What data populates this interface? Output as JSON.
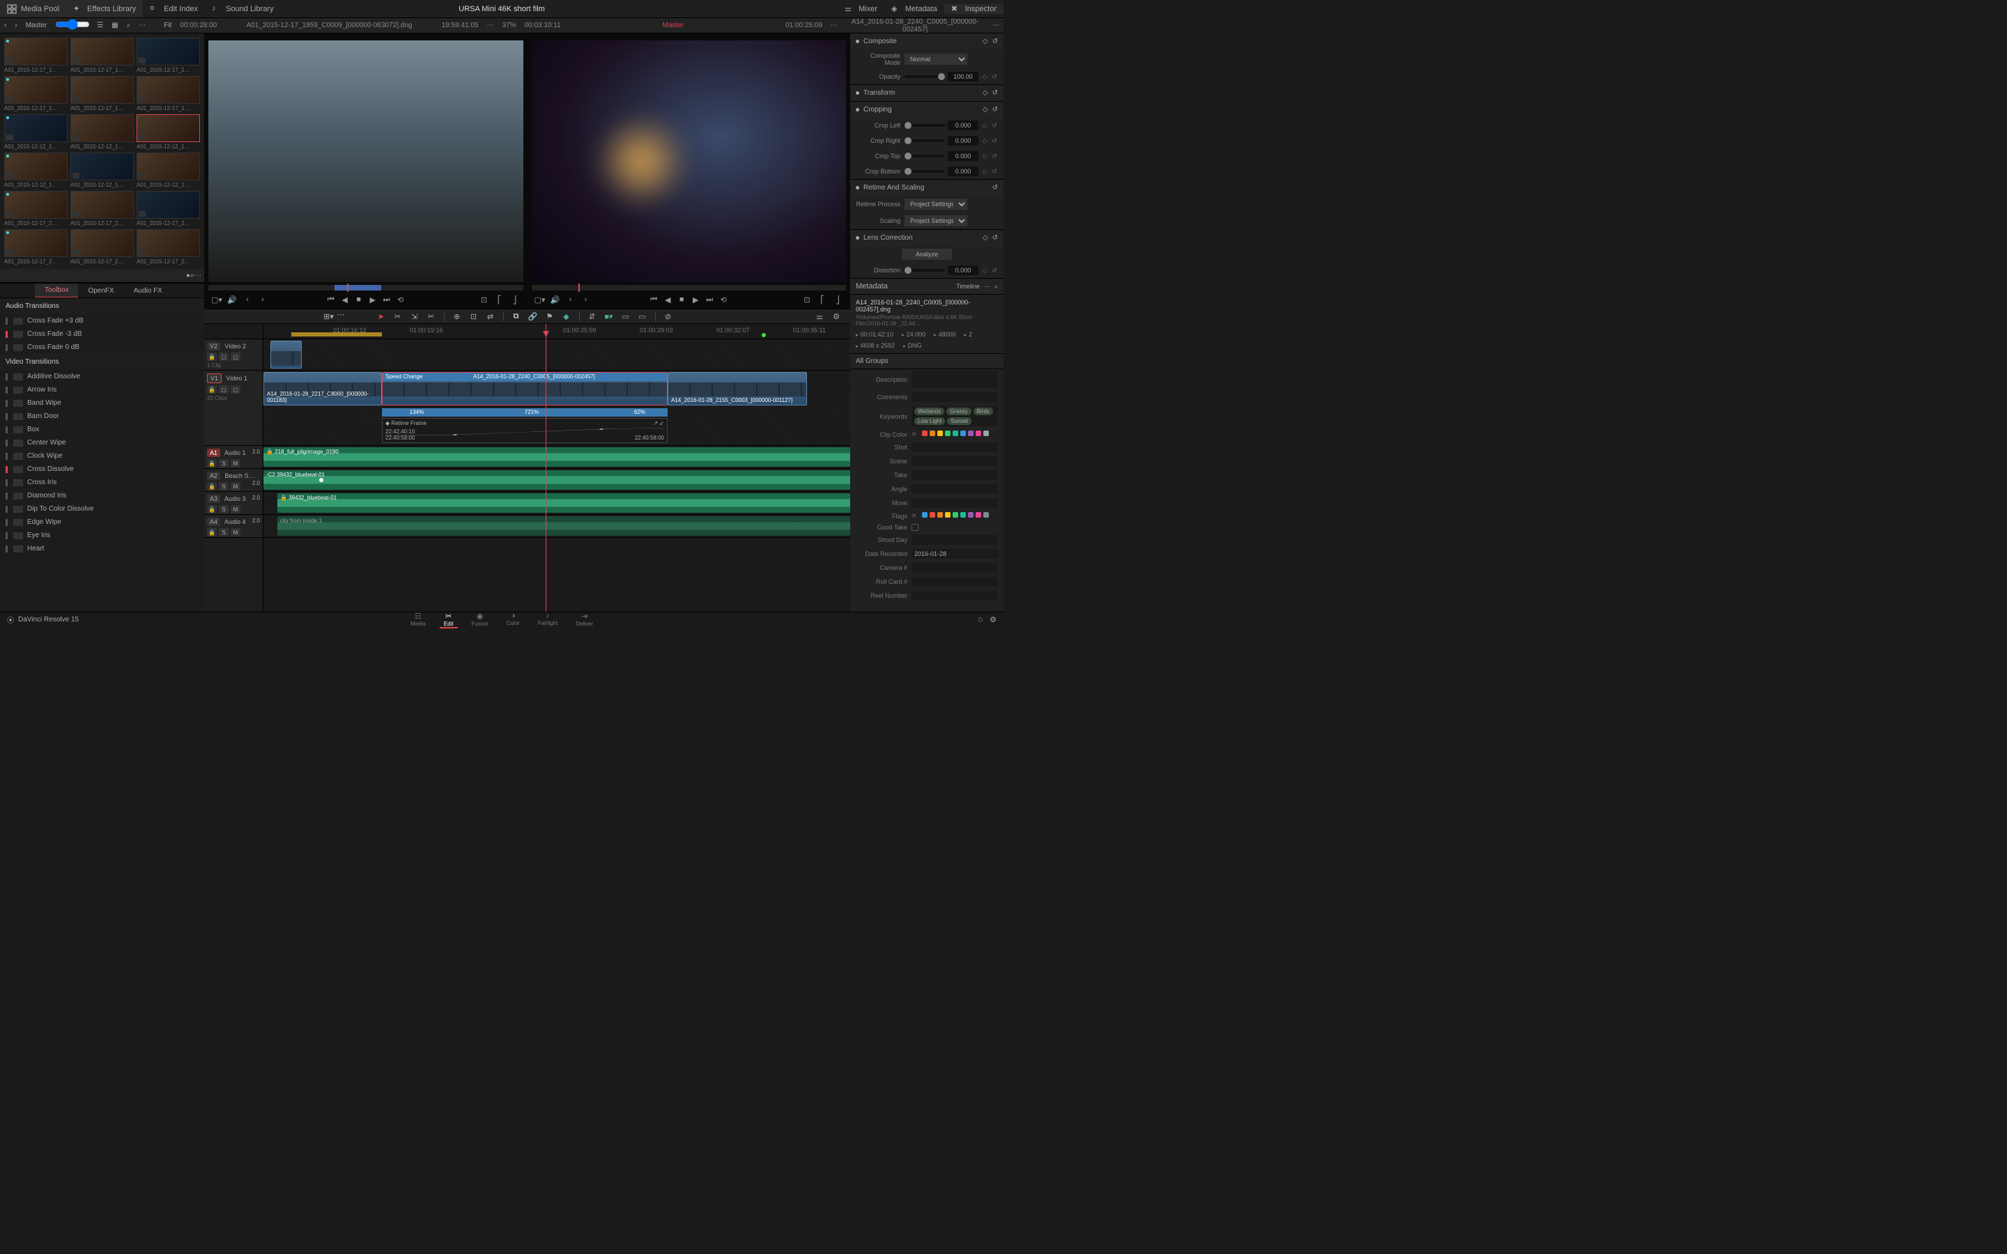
{
  "app": {
    "title": "URSA Mini 46K short film",
    "product": "DaVinci Resolve 15"
  },
  "topbar": {
    "mediaPool": "Media Pool",
    "effectsLibrary": "Effects Library",
    "editIndex": "Edit Index",
    "soundLibrary": "Sound Library",
    "mixer": "Mixer",
    "metadata": "Metadata",
    "inspector": "Inspector"
  },
  "subbar": {
    "master": "Master",
    "fit": "Fit",
    "sourceTC": "00:00:28:00",
    "sourceName": "A01_2015-12-17_1959_C0009_[000000-063072].dng",
    "timeOfDay": "19:59:41:05",
    "zoom": "37%",
    "programTC": "00:03:10:11",
    "timelineMaster": "Master",
    "recordTC": "01:00:25:09",
    "recordName": "A14_2016-01-28_2240_C0005_[000000-002457]"
  },
  "thumbnails": [
    {
      "label": "A01_2015-12-17_1…"
    },
    {
      "label": "A01_2015-12-17_1…"
    },
    {
      "label": "A01_2015-12-17_1…"
    },
    {
      "label": "A01_2015-12-17_1…"
    },
    {
      "label": "A01_2015-12-17_1…"
    },
    {
      "label": "A01_2015-12-17_1…"
    },
    {
      "label": "A01_2015-12-12_1…"
    },
    {
      "label": "A01_2015-12-12_1…"
    },
    {
      "label": "A01_2015-12-12_1…",
      "selected": true
    },
    {
      "label": "A01_2015-12-12_1…"
    },
    {
      "label": "A01_2015-12-12_1…"
    },
    {
      "label": "A01_2015-12-12_1…"
    },
    {
      "label": "A01_2015-12-17_2…"
    },
    {
      "label": "A01_2015-12-17_2…"
    },
    {
      "label": "A01_2015-12-17_2…"
    },
    {
      "label": "A01_2015-12-17_2…"
    },
    {
      "label": "A01_2015-12-17_2…"
    },
    {
      "label": "A01_2015-12-17_2…"
    }
  ],
  "fxTabs": {
    "toolbox": "Toolbox",
    "openfx": "OpenFX",
    "audiofx": "Audio FX"
  },
  "fxSections": {
    "audioTransitions": "Audio Transitions",
    "videoTransitions": "Video Transitions"
  },
  "audioFx": [
    {
      "name": "Cross Fade +3 dB"
    },
    {
      "name": "Cross Fade -3 dB",
      "marked": true
    },
    {
      "name": "Cross Fade 0 dB"
    }
  ],
  "videoFx": [
    {
      "name": "Additive Dissolve"
    },
    {
      "name": "Arrow Iris"
    },
    {
      "name": "Band Wipe"
    },
    {
      "name": "Barn Door"
    },
    {
      "name": "Box"
    },
    {
      "name": "Center Wipe"
    },
    {
      "name": "Clock Wipe"
    },
    {
      "name": "Cross Dissolve",
      "marked": true
    },
    {
      "name": "Cross Iris"
    },
    {
      "name": "Diamond Iris"
    },
    {
      "name": "Dip To Color Dissolve"
    },
    {
      "name": "Edge Wipe"
    },
    {
      "name": "Eye Iris"
    },
    {
      "name": "Heart"
    }
  ],
  "timeline": {
    "playheadTC": "01:00:25:09",
    "ticks": [
      "01:00:16:12",
      "01:00:19:16",
      "01:00:25:09",
      "01:00:29:03",
      "01:00:32:07",
      "01:00:35:11"
    ],
    "tracks": {
      "v2": {
        "badge": "V2",
        "name": "Video 2",
        "sub": "1 Clip"
      },
      "v1": {
        "badge": "V1",
        "name": "Video 1",
        "sub": "20 Clips"
      },
      "a1": {
        "badge": "A1",
        "name": "Audio 1",
        "meter": "2.0"
      },
      "a2": {
        "badge": "A2",
        "name": "Beach S…",
        "meter": "2.0"
      },
      "a3": {
        "badge": "A3",
        "name": "Audio 3",
        "meter": "2.0"
      },
      "a4": {
        "badge": "A4",
        "name": "Audio 4",
        "meter": "2.0"
      }
    },
    "clips": {
      "v1a": "A14_2016-01-28_2217_C8000_[000000-001183]",
      "v1b": "A14_2016-01-28_2240_C0005_[000000-002457]",
      "v1c": "A14_2016-01-28_2155_C0003_[000000-001127]",
      "speedLabel": "Speed Change",
      "speedClip": "A14_2016-01-28_2240_C0005_[000000-002457]",
      "seg1": "134%",
      "seg2": "721%",
      "seg3": "62%",
      "retimeLabel": "Retime Frame",
      "retimeStart": "22:40:58:00",
      "retimeMid": "22:42:40:10",
      "retimeEnd": "22:40:58:00",
      "a1": "218_full_pilgrimage_0190",
      "a2": "-C2  39432_bluebeat-01",
      "a3": "39432_bluebeat-01",
      "a4": "city from inside 1"
    }
  },
  "inspector": {
    "composite": {
      "title": "Composite",
      "mode": "Composite Mode",
      "modeVal": "Normal",
      "opacity": "Opacity",
      "opacityVal": "100.00"
    },
    "transform": {
      "title": "Transform"
    },
    "cropping": {
      "title": "Cropping",
      "left": "Crop Left",
      "right": "Crop Right",
      "top": "Crop Top",
      "bottom": "Crop Bottom",
      "val": "0.000"
    },
    "retime": {
      "title": "Retime And Scaling",
      "process": "Retime Process",
      "processVal": "Project Settings",
      "scaling": "Scaling",
      "scalingVal": "Project Settings"
    },
    "lens": {
      "title": "Lens Correction",
      "analyze": "Analyze",
      "distortion": "Distortion",
      "distortionVal": "0.000"
    }
  },
  "metadata": {
    "header": "Metadata",
    "timeline": "Timeline",
    "filename": "A14_2016-01-28_2240_C0005_[000000-002457].dng",
    "path": "/Volumes/Promise RAID/URSA Mini 4.6K Short Film/2016-01-28 _22.44…",
    "duration": "00:01:42:10",
    "fps": "24.000",
    "res": "48000",
    "ch": "2",
    "dims": "4608 x 2592",
    "codec": "DNG",
    "allGroups": "All Groups",
    "fields": {
      "description": "Description",
      "comments": "Comments",
      "keywords": "Keywords",
      "clipColor": "Clip Color",
      "shot": "Shot",
      "scene": "Scene",
      "take": "Take",
      "angle": "Angle",
      "move": "Move",
      "flags": "Flags",
      "goodTake": "Good Take",
      "shootDay": "Shoot Day",
      "dateRecorded": "Date Recorded",
      "cameraNum": "Camera #",
      "rollCard": "Roll Card #",
      "reelNumber": "Reel Number"
    },
    "keywordTags": [
      "Wetlands",
      "Grassy",
      "Birds",
      "Low Light",
      "Sunset"
    ],
    "dateRecordedVal": "2016-01-28"
  },
  "nav": {
    "pages": [
      "Media",
      "Edit",
      "Fusion",
      "Color",
      "Fairlight",
      "Deliver"
    ],
    "active": "Edit"
  },
  "colors": {
    "swatches": [
      "#e74c3c",
      "#e67e22",
      "#f1c40f",
      "#2ecc71",
      "#1abc9c",
      "#3498db",
      "#9b59b6",
      "#e84393",
      "#95a5a6"
    ],
    "flags": [
      "#3498db",
      "#e74c3c",
      "#e67e22",
      "#f1c40f",
      "#2ecc71",
      "#1abc9c",
      "#9b59b6",
      "#e84393",
      "#7f8c8d"
    ]
  }
}
